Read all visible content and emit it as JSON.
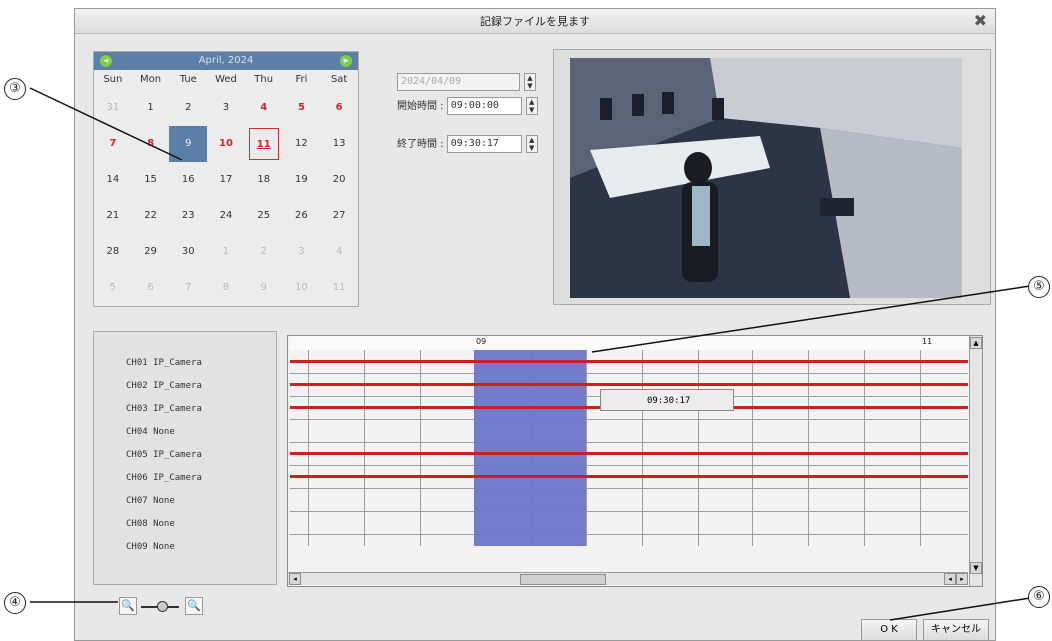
{
  "window": {
    "title": "記録ファイルを見ます"
  },
  "calendar": {
    "month_label": "April, 2024",
    "weekdays": [
      "Sun",
      "Mon",
      "Tue",
      "Wed",
      "Thu",
      "Fri",
      "Sat"
    ],
    "days": [
      {
        "t": "31",
        "s": "dim"
      },
      {
        "t": "1",
        "s": ""
      },
      {
        "t": "2",
        "s": ""
      },
      {
        "t": "3",
        "s": ""
      },
      {
        "t": "4",
        "s": "red"
      },
      {
        "t": "5",
        "s": "red"
      },
      {
        "t": "6",
        "s": "red"
      },
      {
        "t": "7",
        "s": "red"
      },
      {
        "t": "8",
        "s": "red"
      },
      {
        "t": "9",
        "s": "sel"
      },
      {
        "t": "10",
        "s": "red"
      },
      {
        "t": "11",
        "s": "today"
      },
      {
        "t": "12",
        "s": ""
      },
      {
        "t": "13",
        "s": ""
      },
      {
        "t": "14",
        "s": ""
      },
      {
        "t": "15",
        "s": ""
      },
      {
        "t": "16",
        "s": ""
      },
      {
        "t": "17",
        "s": ""
      },
      {
        "t": "18",
        "s": ""
      },
      {
        "t": "19",
        "s": ""
      },
      {
        "t": "20",
        "s": ""
      },
      {
        "t": "21",
        "s": ""
      },
      {
        "t": "22",
        "s": ""
      },
      {
        "t": "23",
        "s": ""
      },
      {
        "t": "24",
        "s": ""
      },
      {
        "t": "25",
        "s": ""
      },
      {
        "t": "26",
        "s": ""
      },
      {
        "t": "27",
        "s": ""
      },
      {
        "t": "28",
        "s": ""
      },
      {
        "t": "29",
        "s": ""
      },
      {
        "t": "30",
        "s": ""
      },
      {
        "t": "1",
        "s": "dim"
      },
      {
        "t": "2",
        "s": "dim"
      },
      {
        "t": "3",
        "s": "dim"
      },
      {
        "t": "4",
        "s": "dim"
      },
      {
        "t": "5",
        "s": "dim"
      },
      {
        "t": "6",
        "s": "dim"
      },
      {
        "t": "7",
        "s": "dim"
      },
      {
        "t": "8",
        "s": "dim"
      },
      {
        "t": "9",
        "s": "dim"
      },
      {
        "t": "10",
        "s": "dim"
      },
      {
        "t": "11",
        "s": "dim"
      }
    ]
  },
  "time": {
    "date_value": "2024/04/09",
    "start_label": "開始時間",
    "start_value": "09:00:00",
    "end_label": "終了時間",
    "end_value": "09:30:17"
  },
  "channels": [
    {
      "label": "CH01 IP_Camera"
    },
    {
      "label": "CH02 IP_Camera"
    },
    {
      "label": "CH03 IP_Camera"
    },
    {
      "label": "CH04 None"
    },
    {
      "label": "CH05 IP_Camera"
    },
    {
      "label": "CH06 IP_Camera"
    },
    {
      "label": "CH07 None"
    },
    {
      "label": "CH08 None"
    },
    {
      "label": "CH09 None"
    }
  ],
  "timeline": {
    "ruler_labels": [
      "09",
      "11"
    ],
    "tooltip": "09:30:17"
  },
  "buttons": {
    "ok": "O K",
    "cancel": "キャンセル"
  },
  "callouts": [
    "③",
    "④",
    "⑤",
    "⑥"
  ]
}
